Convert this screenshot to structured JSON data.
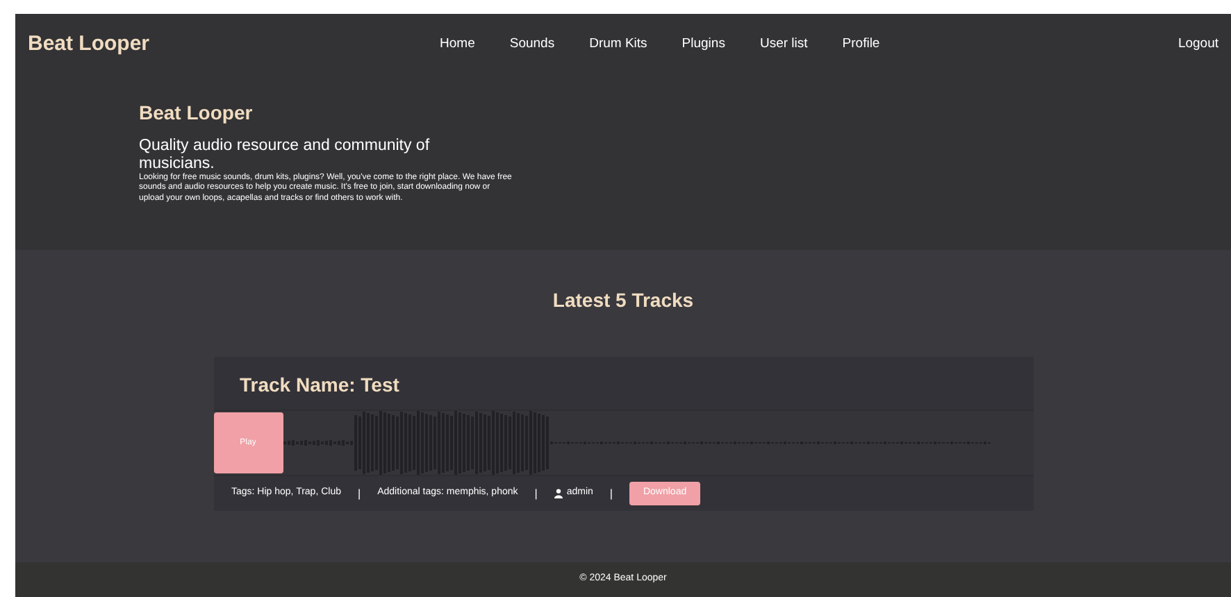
{
  "brand": "Beat Looper",
  "nav": [
    {
      "label": "Home"
    },
    {
      "label": "Sounds"
    },
    {
      "label": "Drum Kits"
    },
    {
      "label": "Plugins"
    },
    {
      "label": "User list"
    },
    {
      "label": "Profile"
    }
  ],
  "logout": "Logout",
  "hero": {
    "title": "Beat Looper",
    "subtitle": "Quality audio resource and community of musicians.",
    "text": "Looking for free music sounds, drum kits, plugins? Well, you've come to the right place. We have free sounds and audio resources to help you create music. It's free to join, start downloading now or upload your own loops, acapellas and tracks or find others to work with."
  },
  "section_title": "Latest 5 Tracks",
  "tracks": [
    {
      "name": "Track Name: Test",
      "play": "Play",
      "tags": "Tags: Hip hop, Trap, Club",
      "additional_tags": "Additional tags: memphis, phonk",
      "user": "admin",
      "download": "Download",
      "separator": "|"
    }
  ],
  "footer": "© 2024 Beat Looper"
}
